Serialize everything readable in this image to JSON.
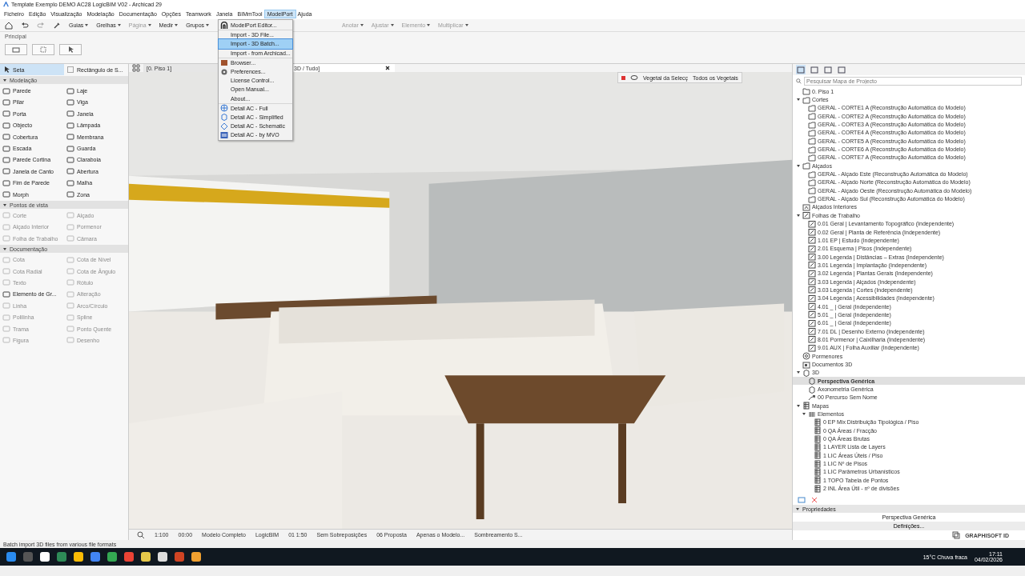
{
  "window": {
    "title": "Template Exemplo DEMO AC28 LogicBIM V02 - Archicad 29"
  },
  "menu_bar": [
    {
      "label": "Ficheiro",
      "selected": false
    },
    {
      "label": "Edição",
      "selected": false
    },
    {
      "label": "Visualização",
      "selected": false
    },
    {
      "label": "Modelação",
      "selected": false
    },
    {
      "label": "Documentação",
      "selected": false
    },
    {
      "label": "Opções",
      "selected": false
    },
    {
      "label": "Teamwork",
      "selected": false
    },
    {
      "label": "Janela",
      "selected": false
    },
    {
      "label": "BIMmTool",
      "selected": false
    },
    {
      "label": "ModelPort",
      "selected": true
    },
    {
      "label": "Ajuda",
      "selected": false
    }
  ],
  "toolbar": {
    "left": [
      {
        "label": "Guias",
        "disabled": false
      },
      {
        "label": "Grelhas",
        "disabled": false
      },
      {
        "label": "Página",
        "disabled": true
      },
      {
        "label": "Medir",
        "disabled": false
      },
      {
        "label": "Grupos",
        "disabled": false
      }
    ],
    "right": [
      {
        "label": "Anotar",
        "disabled": true
      },
      {
        "label": "Ajustar",
        "disabled": true
      },
      {
        "label": "Elemento",
        "disabled": true
      },
      {
        "label": "Multiplicar",
        "disabled": true
      }
    ]
  },
  "info_box": {
    "label": "Principal"
  },
  "toolbox": {
    "top": [
      {
        "label": "Seta",
        "selected": true
      },
      {
        "label": "Rectângulo de S...",
        "selected": false
      }
    ],
    "sections": [
      {
        "title": "Modelação",
        "expanded": true,
        "tools": [
          {
            "label": "Parede",
            "disabled": false
          },
          {
            "label": "Laje",
            "disabled": false
          },
          {
            "label": "Pilar",
            "disabled": false
          },
          {
            "label": "Viga",
            "disabled": false
          },
          {
            "label": "Porta",
            "disabled": false
          },
          {
            "label": "Janela",
            "disabled": false
          },
          {
            "label": "Objecto",
            "disabled": false
          },
          {
            "label": "Lâmpada",
            "disabled": false
          },
          {
            "label": "Cobertura",
            "disabled": false
          },
          {
            "label": "Membrana",
            "disabled": false
          },
          {
            "label": "Escada",
            "disabled": false
          },
          {
            "label": "Guarda",
            "disabled": false
          },
          {
            "label": "Parede Cortina",
            "disabled": false
          },
          {
            "label": "Claraboia",
            "disabled": false
          },
          {
            "label": "Janela de Canto",
            "disabled": false
          },
          {
            "label": "Abertura",
            "disabled": false
          },
          {
            "label": "Fim de Parede",
            "disabled": false
          },
          {
            "label": "Malha",
            "disabled": false
          },
          {
            "label": "Morph",
            "disabled": false
          },
          {
            "label": "Zona",
            "disabled": false
          }
        ]
      },
      {
        "title": "Pontos de vista",
        "expanded": true,
        "tools": [
          {
            "label": "Corte",
            "disabled": true
          },
          {
            "label": "Alçado",
            "disabled": true
          },
          {
            "label": "Alçado Interior",
            "disabled": true
          },
          {
            "label": "Pormenor",
            "disabled": true
          },
          {
            "label": "Folha de Trabalho",
            "disabled": true
          },
          {
            "label": "Câmara",
            "disabled": true
          }
        ]
      },
      {
        "title": "Documentação",
        "expanded": true,
        "tools": [
          {
            "label": "Cota",
            "disabled": true
          },
          {
            "label": "Cota de Nível",
            "disabled": true
          },
          {
            "label": "Cota Radial",
            "disabled": true
          },
          {
            "label": "Cota de Ângulo",
            "disabled": true
          },
          {
            "label": "Texto",
            "disabled": true
          },
          {
            "label": "Rótulo",
            "disabled": true
          },
          {
            "label": "Elemento de Gr...",
            "disabled": false
          },
          {
            "label": "Alteração",
            "disabled": true
          },
          {
            "label": "Linha",
            "disabled": true
          },
          {
            "label": "Arco/Círculo",
            "disabled": true
          },
          {
            "label": "Polilinha",
            "disabled": true
          },
          {
            "label": "Spline",
            "disabled": true
          },
          {
            "label": "Trama",
            "disabled": true
          },
          {
            "label": "Ponto Quente",
            "disabled": true
          },
          {
            "label": "Figura",
            "disabled": true
          },
          {
            "label": "Desenho",
            "disabled": true
          }
        ]
      }
    ]
  },
  "menu": {
    "groups": [
      [
        {
          "label": "ModelPort Editor...",
          "kind": "editor",
          "selected": false
        }
      ],
      [
        {
          "label": "Import - 3D File...",
          "kind": "plain",
          "selected": false
        },
        {
          "label": "Import - 3D Batch...",
          "kind": "plain",
          "selected": true
        },
        {
          "label": "Import - from Archicad...",
          "kind": "plain",
          "selected": false
        }
      ],
      [
        {
          "label": "Browser...",
          "kind": "browser",
          "selected": false
        },
        {
          "label": "Preferences...",
          "kind": "settings",
          "selected": false
        },
        {
          "label": "License Control...",
          "kind": "plain",
          "selected": false
        },
        {
          "label": "Open Manual...",
          "kind": "plain",
          "selected": false
        },
        {
          "label": "About...",
          "kind": "plain",
          "selected": false
        }
      ],
      [
        {
          "label": "Detail AC - Full",
          "kind": "full",
          "selected": false
        },
        {
          "label": "Detail AC - Simplified",
          "kind": "simplified",
          "selected": false
        },
        {
          "label": "Detail AC - Schematic",
          "kind": "schematic",
          "selected": false
        },
        {
          "label": "Detail AC - by MVO",
          "kind": "mvo",
          "selected": false
        }
      ]
    ]
  },
  "viewport": {
    "tabs": [
      {
        "label": "[0. Piso 1]",
        "selected": false
      },
      {
        "label": "3D / Tudo]",
        "selected": true
      }
    ],
    "palette": {
      "labels": [
        "Vegetal da Selecç",
        "Todos os Vegetais"
      ]
    },
    "status": [
      "1:100",
      "00:00",
      "Modelo Completo",
      "LogicBIM",
      "01 1:50",
      "Sem Sobreposições",
      "06 Proposta",
      "Apenas o Modelo...",
      "Sombreamento S..."
    ]
  },
  "navigator": {
    "views": [
      {
        "selected": true
      },
      {
        "selected": false
      },
      {
        "selected": false
      },
      {
        "selected": false
      }
    ],
    "search": {
      "placeholder": "Pesquisar Mapa de Projecto"
    },
    "tree": [
      {
        "label": "0. Piso 1",
        "kind": "floor",
        "selected": false
      },
      {
        "label": "Cortes",
        "kind": "section",
        "selected": false,
        "expanded": true,
        "children": [
          {
            "label": "GERAL - CORTE1 A (Reconstrução Automática do Modelo)",
            "kind": "section",
            "selected": false
          },
          {
            "label": "GERAL - CORTE2 A (Reconstrução Automática do Modelo)",
            "kind": "section",
            "selected": false
          },
          {
            "label": "GERAL - CORTE3 A (Reconstrução Automática do Modelo)",
            "kind": "section",
            "selected": false
          },
          {
            "label": "GERAL - CORTE4 A (Reconstrução Automática do Modelo)",
            "kind": "section",
            "selected": false
          },
          {
            "label": "GERAL - CORTE5 A (Reconstrução Automática do Modelo)",
            "kind": "section",
            "selected": false
          },
          {
            "label": "GERAL - CORTE6 A (Reconstrução Automática do Modelo)",
            "kind": "section",
            "selected": false
          },
          {
            "label": "GERAL - CORTE7 A (Reconstrução Automática do Modelo)",
            "kind": "section",
            "selected": false
          }
        ]
      },
      {
        "label": "Alçados",
        "kind": "section",
        "selected": false,
        "expanded": true,
        "children": [
          {
            "label": "GERAL - Alçado Este (Reconstrução Automática do Modelo)",
            "kind": "section",
            "selected": false
          },
          {
            "label": "GERAL - Alçado Norte (Reconstrução Automática do Modelo)",
            "kind": "section",
            "selected": false
          },
          {
            "label": "GERAL - Alçado Oeste (Reconstrução Automática do Modelo)",
            "kind": "section",
            "selected": false
          },
          {
            "label": "GERAL - Alçado Sul (Reconstrução Automática do Modelo)",
            "kind": "section",
            "selected": false
          }
        ]
      },
      {
        "label": "Alçados Interiores",
        "kind": "interior",
        "selected": false
      },
      {
        "label": "Folhas de Trabalho",
        "kind": "worksheet",
        "selected": false,
        "expanded": true,
        "children": [
          {
            "label": "0.01 Geral | Levantamento Topográfico (Independente)",
            "kind": "worksheet",
            "selected": false
          },
          {
            "label": "0.02 Geral | Planta de Referência (Independente)",
            "kind": "worksheet",
            "selected": false
          },
          {
            "label": "1.01 EP | Estudo (Independente)",
            "kind": "worksheet",
            "selected": false
          },
          {
            "label": "2.01 Esquema | Pisos (Independente)",
            "kind": "worksheet",
            "selected": false
          },
          {
            "label": "3.00 Legenda | Distâncias – Extras (Independente)",
            "kind": "worksheet",
            "selected": false
          },
          {
            "label": "3.01 Legenda | Implantação (Independente)",
            "kind": "worksheet",
            "selected": false
          },
          {
            "label": "3.02 Legenda | Plantas Gerais (Independente)",
            "kind": "worksheet",
            "selected": false
          },
          {
            "label": "3.03 Legenda | Alçados (Independente)",
            "kind": "worksheet",
            "selected": false
          },
          {
            "label": "3.03 Legenda | Cortes (Independente)",
            "kind": "worksheet",
            "selected": false
          },
          {
            "label": "3.04 Legenda | Acessibilidades (Independente)",
            "kind": "worksheet",
            "selected": false
          },
          {
            "label": "4.01 _ | Geral (Independente)",
            "kind": "worksheet",
            "selected": false
          },
          {
            "label": "5.01 _ | Geral (Independente)",
            "kind": "worksheet",
            "selected": false
          },
          {
            "label": "6.01 _ | Geral (Independente)",
            "kind": "worksheet",
            "selected": false
          },
          {
            "label": "7.01 DL | Desenho Externo (Independente)",
            "kind": "worksheet",
            "selected": false
          },
          {
            "label": "8.01 Pormenor | Caixilharia (Independente)",
            "kind": "worksheet",
            "selected": false
          },
          {
            "label": "9.01 AUX | Folha Auxiliar (Independente)",
            "kind": "worksheet",
            "selected": false
          }
        ]
      },
      {
        "label": "Pormenores",
        "kind": "detail",
        "selected": false
      },
      {
        "label": "Documentos 3D",
        "kind": "doc3d",
        "selected": false
      },
      {
        "label": "3D",
        "kind": "view3d",
        "selected": false,
        "expanded": true,
        "children": [
          {
            "label": "Perspectiva Genérica",
            "kind": "view3d",
            "selected": true
          },
          {
            "label": "Axonometria Genérica",
            "kind": "view3d",
            "selected": false
          },
          {
            "label": "00 Percurso Sem Nome",
            "kind": "path",
            "selected": false
          }
        ]
      },
      {
        "label": "Mapas",
        "kind": "schedule",
        "selected": false,
        "expanded": true,
        "children": [
          {
            "label": "Elementos",
            "kind": "schedules",
            "selected": false,
            "expanded": true,
            "children": [
              {
                "label": "0 EP Mix Distribuição Tipológica / Piso",
                "kind": "schedule",
                "selected": false
              },
              {
                "label": "0 QA Áreas / Fracção",
                "kind": "schedule",
                "selected": false
              },
              {
                "label": "0 QA Áreas Brutas",
                "kind": "schedule",
                "selected": false
              },
              {
                "label": "1 LAYER Lista de Layers",
                "kind": "schedule",
                "selected": false
              },
              {
                "label": "1 LIC Áreas Úteis / Piso",
                "kind": "schedule",
                "selected": false
              },
              {
                "label": "1 LIC Nº de Pisos",
                "kind": "schedule",
                "selected": false
              },
              {
                "label": "1 LIC Parâmetros Urbanísticos",
                "kind": "schedule",
                "selected": false
              },
              {
                "label": "1 TOPO Tabela de Pontos",
                "kind": "schedule",
                "selected": false
              },
              {
                "label": "2 INL Área Útil - nº de divisões",
                "kind": "schedule",
                "selected": false
              }
            ]
          }
        ]
      }
    ],
    "properties": {
      "title": "Propriedades",
      "expanded": true,
      "value": "Perspectiva Genérica",
      "button": "Definições..."
    },
    "brand": "GRAPHISOFT ID"
  },
  "status_text": "Batch import 3D files from various file formats",
  "taskbar": {
    "weather": "15°C Chuva fraca",
    "time": "17:11",
    "date": "04/02/2026"
  }
}
